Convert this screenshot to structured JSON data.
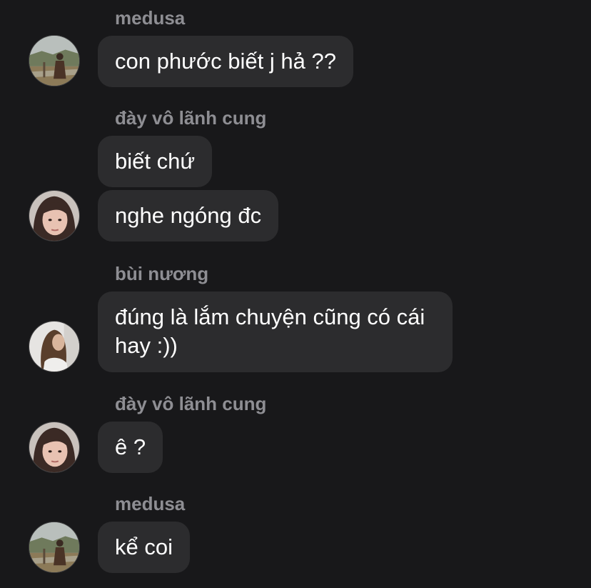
{
  "messages": [
    {
      "sender": "medusa",
      "lines": [
        "con phước biết j hả ??"
      ],
      "avatar": "landscape-woman-avatar"
    },
    {
      "sender": "đày vô lãnh cung",
      "lines": [
        "biết chứ",
        "nghe ngóng đc"
      ],
      "avatar": "selfie-girl-avatar"
    },
    {
      "sender": "bùi nương",
      "lines": [
        "đúng là lắm chuyện cũng có cái hay :))"
      ],
      "avatar": "long-hair-woman-avatar"
    },
    {
      "sender": "đày vô lãnh cung",
      "lines": [
        "ê ?"
      ],
      "avatar": "selfie-girl-avatar"
    },
    {
      "sender": "medusa",
      "lines": [
        "kể coi"
      ],
      "avatar": "landscape-woman-avatar"
    }
  ],
  "colors": {
    "background": "#18181a",
    "bubble": "#2c2c2e",
    "sender_name": "#8e8e93",
    "message_text": "#ffffff"
  }
}
